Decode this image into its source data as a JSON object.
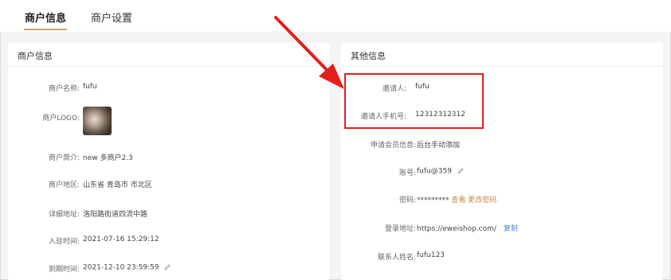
{
  "tabs": [
    {
      "label": "商户信息"
    },
    {
      "label": "商户设置"
    }
  ],
  "left_panel": {
    "title": "商户信息",
    "fields": {
      "name": {
        "label": "商户名称:",
        "value": "fufu"
      },
      "logo": {
        "label": "商户LOGO:"
      },
      "intro": {
        "label": "商户简介:",
        "value": "new 多商户2.3"
      },
      "region": {
        "label": "商户地区:",
        "value": "山东省 青岛市 市北区"
      },
      "address": {
        "label": "详细地址:",
        "value": "洛阳路街道四流中路"
      },
      "join_time": {
        "label": "入驻时间:",
        "value": "2021-07-16 15:29:12"
      },
      "expire_time": {
        "label": "到期时间:",
        "value": "2021-12-10 23:59:59"
      }
    }
  },
  "right_panel": {
    "title": "其他信息",
    "fields": {
      "inviter": {
        "label": "邀请人:",
        "value": "fufu"
      },
      "inviter_phone": {
        "label": "邀请人手机号:",
        "value": "12312312312"
      },
      "member_info": {
        "label": "申请会员信息:",
        "value": "后台手动添加"
      },
      "account": {
        "label": "账号:",
        "value": "fufu@359"
      },
      "password": {
        "label": "密码:",
        "value": "*********",
        "view_link": "查看",
        "change_link": "更改密码"
      },
      "login_url": {
        "label": "登录地址:",
        "value": "https://eweishop.com/",
        "copy_link": "复制"
      },
      "contact_name": {
        "label": "联系人姓名:",
        "value": "fufu123"
      }
    }
  },
  "colors": {
    "accent": "#c8a26a",
    "link_orange": "#c8894a",
    "link_blue": "#4a89c8",
    "highlight_red": "#e0201c"
  }
}
